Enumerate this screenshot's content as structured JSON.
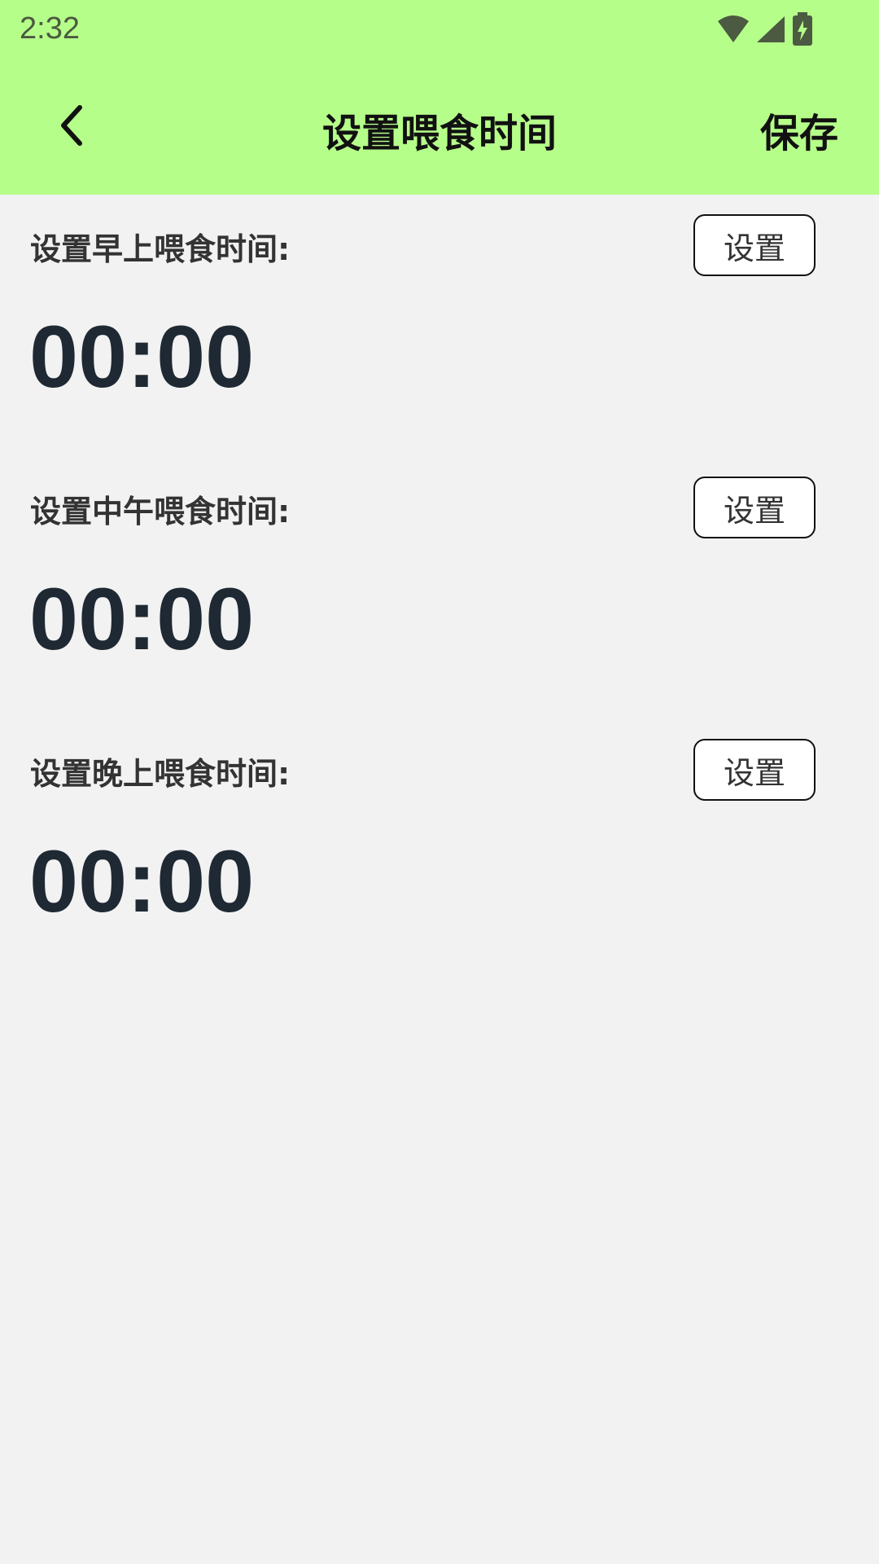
{
  "status_bar": {
    "time": "2:32",
    "icons": [
      "wifi-icon",
      "signal-icon",
      "battery-charging-icon"
    ]
  },
  "toolbar": {
    "back_icon": "chevron-left-icon",
    "title": "设置喂食时间",
    "save_label": "保存"
  },
  "sections": [
    {
      "label": "设置早上喂食时间:",
      "button_label": "设置",
      "time": "00:00"
    },
    {
      "label": "设置中午喂食时间:",
      "button_label": "设置",
      "time": "00:00"
    },
    {
      "label": "设置晚上喂食时间:",
      "button_label": "设置",
      "time": "00:00"
    }
  ],
  "colors": {
    "header_bg": "#b6fe8a",
    "page_bg": "#f2f2f2",
    "time_text": "#1f2933"
  }
}
